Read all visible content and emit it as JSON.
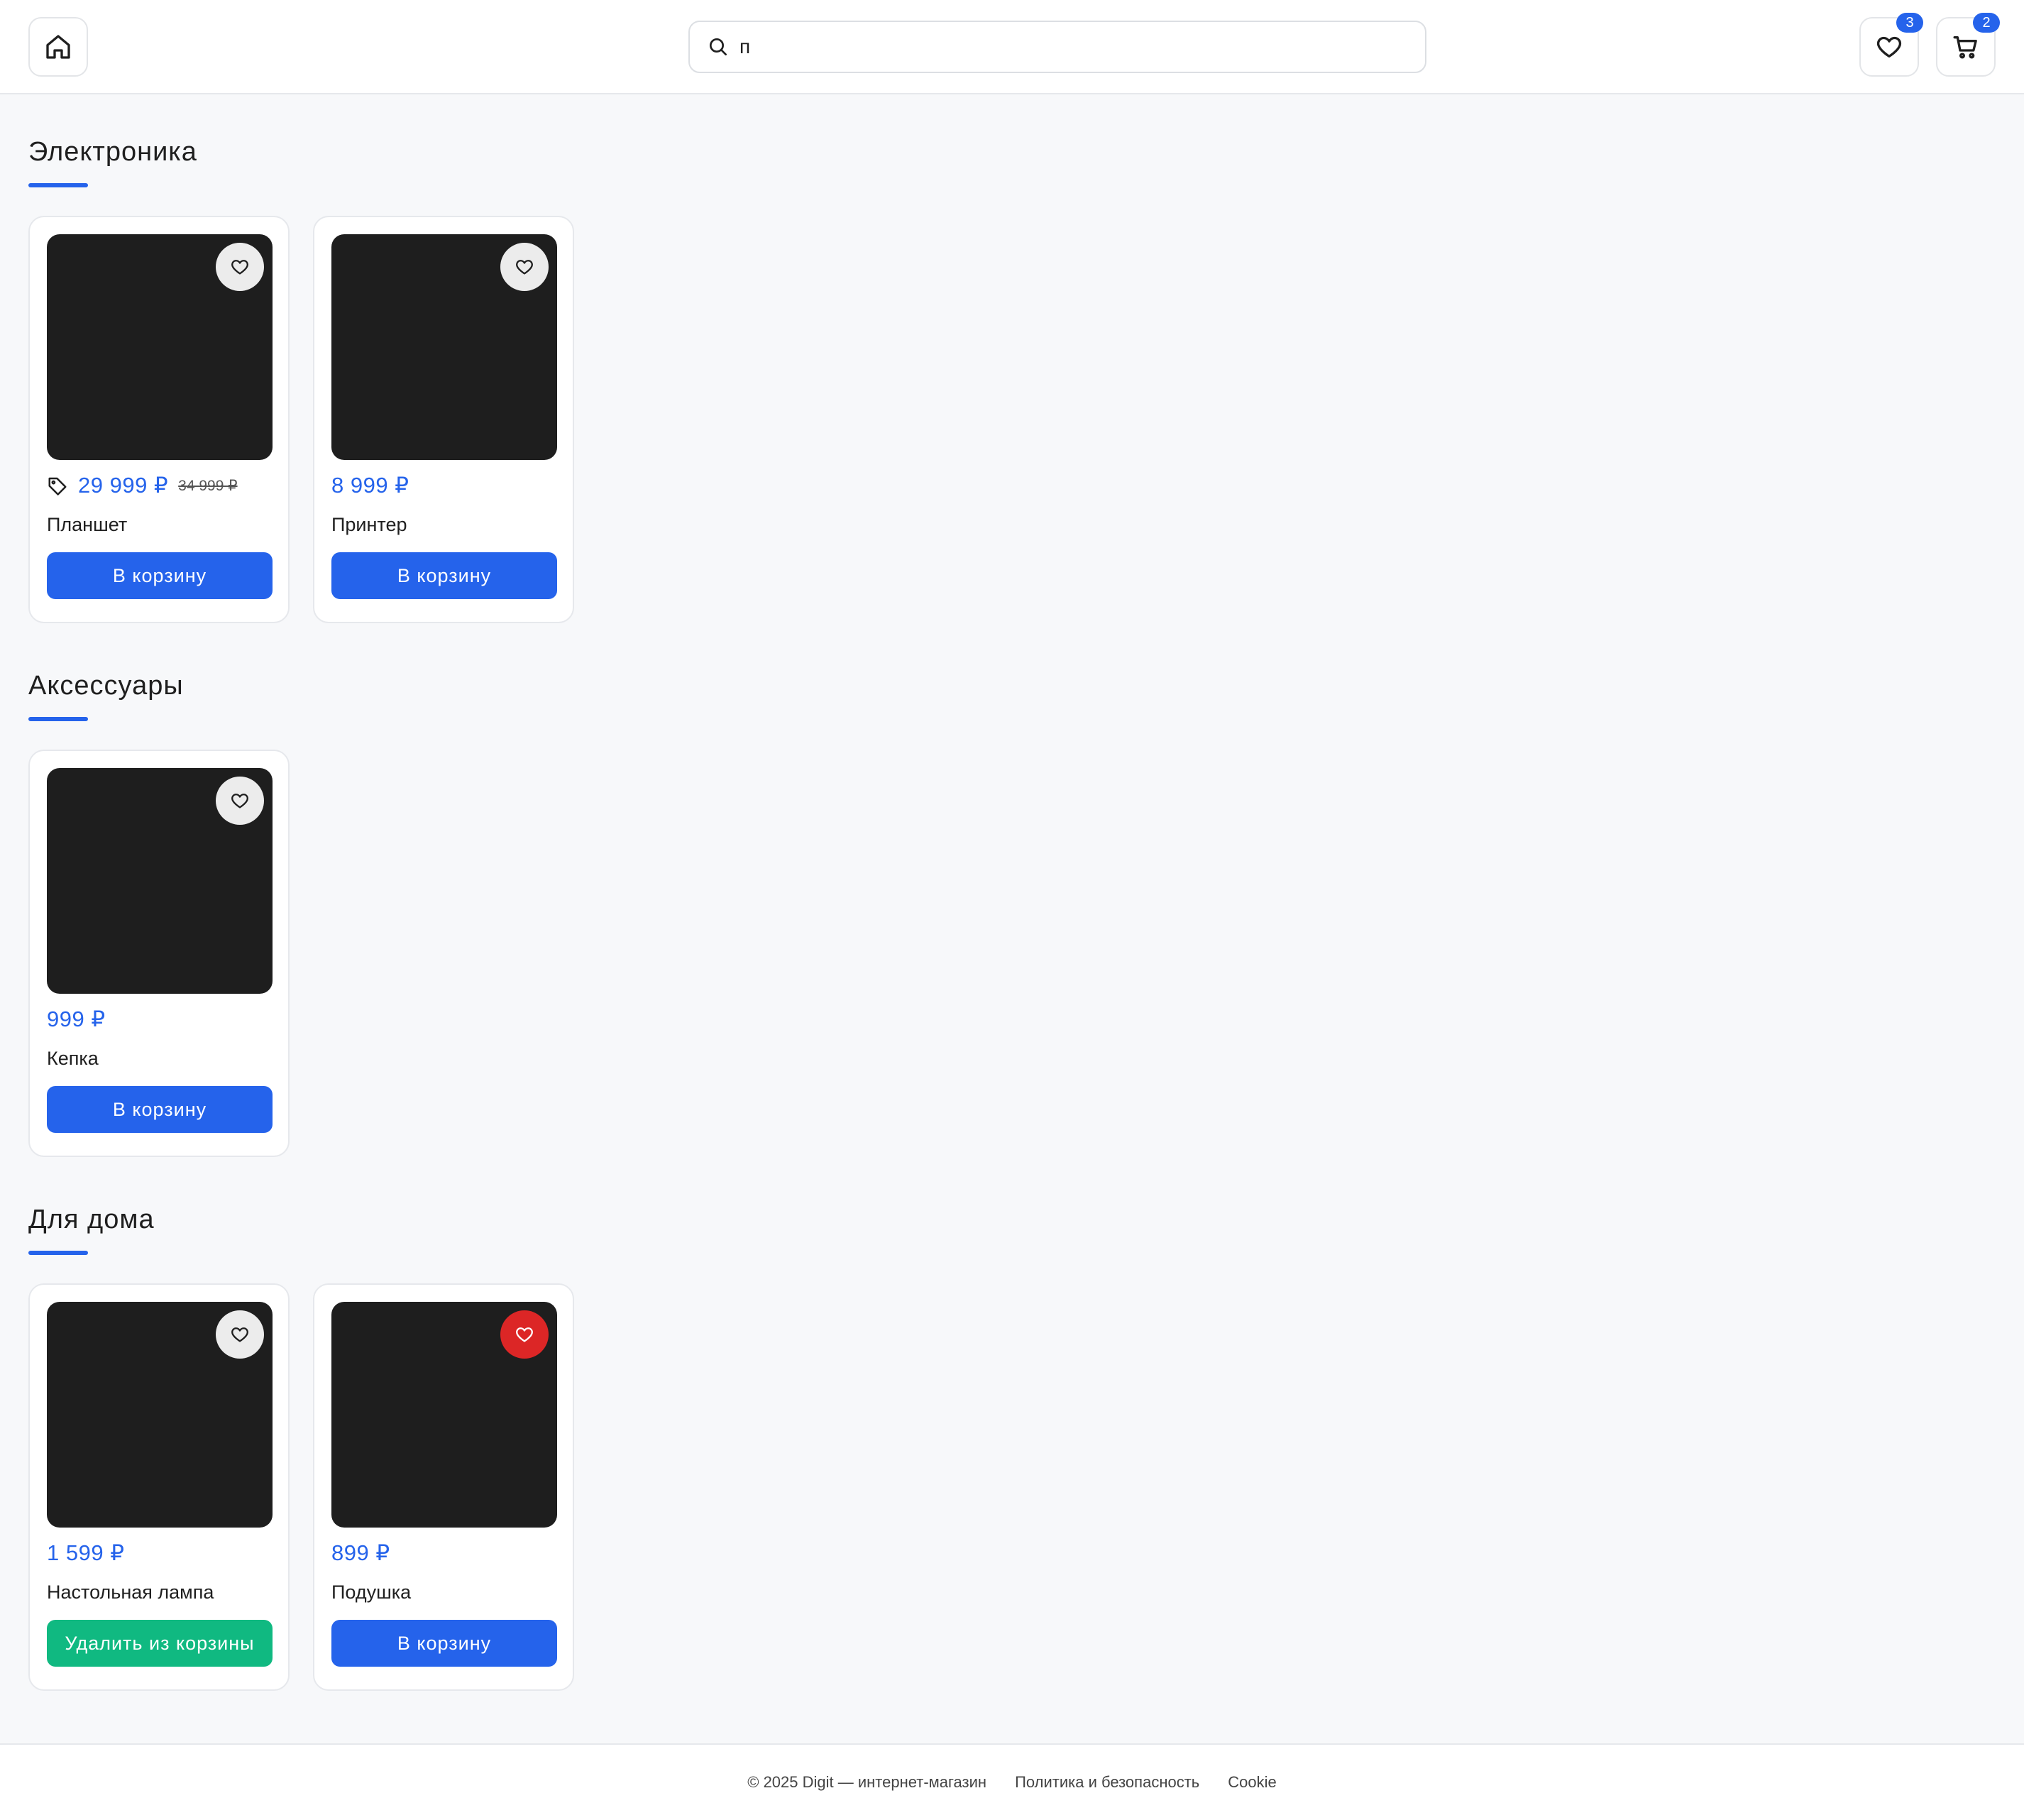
{
  "header": {
    "search_value": "п",
    "search_placeholder": "",
    "favorites_count": "3",
    "cart_count": "2"
  },
  "colors": {
    "accent": "#2563eb",
    "success": "#10b981",
    "favorite_active": "#dc2626",
    "image_placeholder": "#1e1e1e"
  },
  "sections": [
    {
      "title": "Электроника",
      "products": [
        {
          "name": "Планшет",
          "price": "29 999 ₽",
          "old_price": "34 999 ₽",
          "button": "В корзину",
          "favorite": false,
          "discount_tag": true
        },
        {
          "name": "Принтер",
          "price": "8 999 ₽",
          "button": "В корзину",
          "favorite": false
        }
      ]
    },
    {
      "title": "Аксессуары",
      "products": [
        {
          "name": "Кепка",
          "price": "999 ₽",
          "button": "В корзину",
          "favorite": false
        }
      ]
    },
    {
      "title": "Для дома",
      "products": [
        {
          "name": "Настольная лампа",
          "price": "1 599 ₽",
          "button": "Удалить из корзины",
          "favorite": false,
          "in_cart": true
        },
        {
          "name": "Подушка",
          "price": "899 ₽",
          "button": "В корзину",
          "favorite": true
        }
      ]
    }
  ],
  "footer": {
    "copyright": "© 2025 Digit — интернет-магазин",
    "privacy_link": "Политика и безопасность",
    "cookie_link": "Cookie"
  }
}
